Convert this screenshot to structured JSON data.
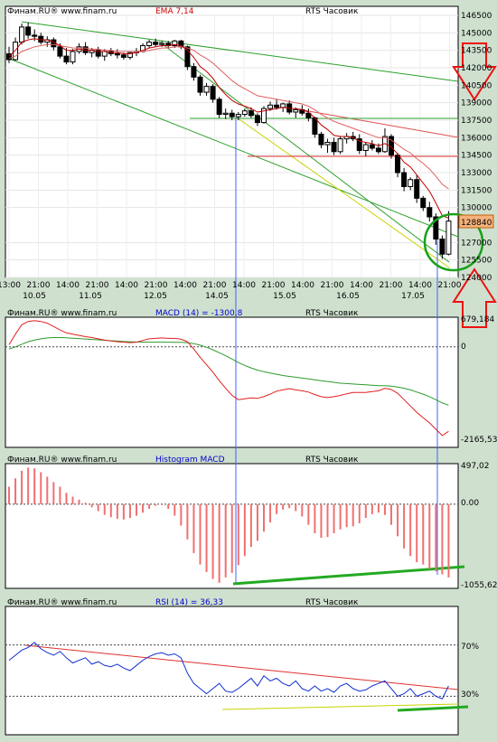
{
  "chart_data": [
    {
      "type": "candlestick",
      "header": {
        "source": "Финам.RU®  www.finam.ru",
        "indicator": "EMA 7,14",
        "instrument": "RTS Часовик"
      },
      "y_ticks": [
        "146500",
        "145000",
        "143500",
        "142000",
        "140500",
        "139000",
        "137500",
        "136000",
        "134500",
        "133000",
        "131500",
        "130000",
        "127000",
        "125500",
        "124000"
      ],
      "last_price_label": "128840",
      "ylim": [
        124000,
        146500
      ],
      "time_ticks": [
        "13:00",
        "21:00",
        "14:00",
        "21:00",
        "14:00",
        "21:00",
        "14:00",
        "21:00",
        "14:00",
        "21:00",
        "14:00",
        "21:00",
        "14:00",
        "21:00",
        "14:00",
        "21:00"
      ],
      "date_ticks": [
        "10.05",
        "11.05",
        "12.05",
        "14.05",
        "15.05",
        "16.05",
        "17.05"
      ],
      "candles": [
        [
          143200,
          143800,
          142400,
          142700
        ],
        [
          142700,
          144600,
          142600,
          144200
        ],
        [
          144200,
          145800,
          144000,
          145500
        ],
        [
          145500,
          145900,
          144500,
          144800
        ],
        [
          144800,
          145300,
          144300,
          144700
        ],
        [
          144700,
          145000,
          144000,
          144200
        ],
        [
          144200,
          144700,
          143800,
          144400
        ],
        [
          144400,
          144600,
          143500,
          143800
        ],
        [
          143800,
          144100,
          142800,
          143000
        ],
        [
          143000,
          143700,
          142300,
          142500
        ],
        [
          142500,
          143600,
          142300,
          143400
        ],
        [
          143400,
          144100,
          143200,
          143800
        ],
        [
          143800,
          144200,
          143100,
          143300
        ],
        [
          143300,
          143700,
          142900,
          143500
        ],
        [
          143500,
          143800,
          142800,
          143000
        ],
        [
          143000,
          143600,
          142600,
          143400
        ],
        [
          143400,
          143700,
          143000,
          143200
        ],
        [
          143200,
          143600,
          142800,
          143100
        ],
        [
          143100,
          143300,
          142700,
          142900
        ],
        [
          142900,
          143400,
          142700,
          143300
        ],
        [
          143300,
          143700,
          143000,
          143400
        ],
        [
          143400,
          144100,
          143300,
          143900
        ],
        [
          143900,
          144400,
          143700,
          144200
        ],
        [
          144200,
          144500,
          143800,
          144000
        ],
        [
          144000,
          144300,
          143800,
          144100
        ],
        [
          144100,
          144300,
          143700,
          143900
        ],
        [
          143900,
          144400,
          143700,
          144300
        ],
        [
          144300,
          144400,
          143600,
          143800
        ],
        [
          143800,
          143900,
          141800,
          142100
        ],
        [
          142100,
          142400,
          140900,
          141200
        ],
        [
          141200,
          141400,
          139600,
          139900
        ],
        [
          139900,
          140700,
          139600,
          140400
        ],
        [
          140400,
          140600,
          139000,
          139300
        ],
        [
          139300,
          139500,
          137700,
          138000
        ],
        [
          138000,
          138500,
          137600,
          138100
        ],
        [
          138100,
          138400,
          137500,
          137800
        ],
        [
          137800,
          138200,
          137500,
          138000
        ],
        [
          138000,
          138500,
          137800,
          138300
        ],
        [
          138300,
          138600,
          137700,
          137900
        ],
        [
          137900,
          138100,
          137000,
          137300
        ],
        [
          137300,
          138700,
          137200,
          138500
        ],
        [
          138500,
          139100,
          138300,
          138800
        ],
        [
          138800,
          139300,
          138400,
          138600
        ],
        [
          138600,
          139000,
          138200,
          138900
        ],
        [
          138900,
          139200,
          138000,
          138200
        ],
        [
          138200,
          138600,
          137700,
          138400
        ],
        [
          138400,
          138800,
          137900,
          138100
        ],
        [
          138100,
          138500,
          137400,
          137700
        ],
        [
          137700,
          137800,
          136000,
          136300
        ],
        [
          136300,
          136500,
          135100,
          135400
        ],
        [
          135400,
          135900,
          134700,
          135600
        ],
        [
          135600,
          136000,
          134500,
          134800
        ],
        [
          134800,
          136100,
          134600,
          135900
        ],
        [
          135900,
          136400,
          135500,
          136100
        ],
        [
          136100,
          136500,
          135700,
          135900
        ],
        [
          135900,
          136300,
          134600,
          134900
        ],
        [
          134900,
          135600,
          134400,
          135400
        ],
        [
          135400,
          135800,
          134900,
          135100
        ],
        [
          135100,
          135500,
          134600,
          134800
        ],
        [
          134800,
          136800,
          134700,
          136100
        ],
        [
          136100,
          136300,
          134200,
          134500
        ],
        [
          134500,
          134700,
          132600,
          133000
        ],
        [
          133000,
          133400,
          131400,
          131800
        ],
        [
          131800,
          132600,
          131500,
          132400
        ],
        [
          132400,
          132800,
          130400,
          130800
        ],
        [
          130800,
          131000,
          129700,
          130000
        ],
        [
          130000,
          130500,
          128800,
          129200
        ],
        [
          129200,
          129500,
          126800,
          127300
        ],
        [
          127300,
          127600,
          125600,
          126000
        ],
        [
          126000,
          129700,
          125900,
          128840
        ]
      ],
      "ema_fast": [
        143000,
        143500,
        144200,
        144400,
        144500,
        144400,
        144400,
        144200,
        143900,
        143500,
        143500,
        143600,
        143500,
        143500,
        143400,
        143400,
        143300,
        143300,
        143200,
        143200,
        143300,
        143500,
        143700,
        143800,
        143900,
        143900,
        144000,
        143900,
        143500,
        142900,
        142100,
        141700,
        141100,
        140300,
        139700,
        139200,
        138900,
        138700,
        138500,
        138200,
        138300,
        138400,
        138500,
        138600,
        138500,
        138500,
        138400,
        138200,
        137700,
        137100,
        136700,
        136200,
        136100,
        136100,
        136000,
        135700,
        135600,
        135500,
        135300,
        135500,
        135200,
        134600,
        133900,
        133500,
        132800,
        132100,
        131400,
        130400,
        129300,
        129100
      ],
      "ema_slow": [
        142800,
        143000,
        143400,
        143600,
        143800,
        143900,
        144000,
        144000,
        143900,
        143800,
        143700,
        143700,
        143700,
        143600,
        143600,
        143500,
        143500,
        143400,
        143400,
        143400,
        143400,
        143400,
        143500,
        143600,
        143700,
        143700,
        143800,
        143800,
        143700,
        143500,
        143100,
        142800,
        142400,
        141900,
        141400,
        140900,
        140500,
        140200,
        139900,
        139600,
        139500,
        139400,
        139300,
        139200,
        139100,
        139000,
        138900,
        138700,
        138400,
        138000,
        137700,
        137400,
        137200,
        137000,
        136800,
        136600,
        136400,
        136200,
        136000,
        136000,
        135800,
        135400,
        135000,
        134700,
        134200,
        133800,
        133300,
        132700,
        132000,
        131600
      ],
      "macd_header": {
        "source": "Финам.RU®  www.finam.ru",
        "indicator": "MACD (14) = -1300,8",
        "instrument": "RTS Часовик"
      },
      "macd_ticks": [
        "679,184",
        "0",
        "-2165,532"
      ],
      "macd_ylim": [
        -2165.532,
        679.184
      ],
      "macd_line": [
        50,
        300,
        520,
        600,
        620,
        600,
        560,
        480,
        400,
        330,
        300,
        270,
        240,
        220,
        190,
        160,
        140,
        120,
        110,
        100,
        110,
        150,
        190,
        200,
        210,
        200,
        200,
        180,
        120,
        -50,
        -250,
        -420,
        -600,
        -800,
        -980,
        -1150,
        -1250,
        -1230,
        -1210,
        -1220,
        -1180,
        -1120,
        -1050,
        -1020,
        -990,
        -1020,
        -1040,
        -1070,
        -1130,
        -1180,
        -1200,
        -1180,
        -1150,
        -1110,
        -1080,
        -1080,
        -1080,
        -1060,
        -1040,
        -980,
        -1010,
        -1100,
        -1250,
        -1400,
        -1550,
        -1680,
        -1800,
        -1950,
        -2100,
        -2000
      ],
      "macd_signal": [
        -50,
        0,
        60,
        120,
        160,
        190,
        210,
        220,
        220,
        215,
        205,
        195,
        185,
        175,
        165,
        155,
        145,
        135,
        125,
        120,
        115,
        112,
        110,
        110,
        110,
        110,
        108,
        105,
        95,
        75,
        40,
        -10,
        -70,
        -140,
        -210,
        -290,
        -370,
        -440,
        -500,
        -550,
        -590,
        -620,
        -650,
        -680,
        -700,
        -720,
        -740,
        -760,
        -780,
        -800,
        -820,
        -840,
        -860,
        -870,
        -880,
        -890,
        -900,
        -910,
        -920,
        -920,
        -930,
        -950,
        -980,
        -1020,
        -1070,
        -1120,
        -1180,
        -1250,
        -1330,
        -1380
      ],
      "hist_header": {
        "source": "Финам.RU®  www.finam.ru",
        "indicator": "Histogram MACD",
        "instrument": "RTS Часовик"
      },
      "hist_ticks": [
        "497,02",
        "0.00",
        "-1055,62"
      ],
      "hist_ylim": [
        -1055.62,
        497.02
      ],
      "histogram": [
        230,
        340,
        440,
        480,
        470,
        420,
        360,
        290,
        230,
        150,
        100,
        60,
        20,
        -40,
        -90,
        -140,
        -170,
        -190,
        -200,
        -180,
        -150,
        -110,
        -60,
        -20,
        -10,
        -60,
        -150,
        -280,
        -460,
        -640,
        -790,
        -890,
        -980,
        -1030,
        -960,
        -900,
        -800,
        -680,
        -560,
        -480,
        -360,
        -240,
        -130,
        -70,
        -50,
        -90,
        -160,
        -270,
        -380,
        -440,
        -430,
        -380,
        -330,
        -300,
        -290,
        -250,
        -180,
        -130,
        -110,
        -140,
        -270,
        -420,
        -580,
        -680,
        -760,
        -790,
        -850,
        -880,
        -920,
        -960
      ],
      "rsi_header": {
        "source": "Финам.RU®  www.finam.ru",
        "indicator": "RSI (14) = 36,33",
        "instrument": "RTS Часовик"
      },
      "rsi_ticks": [
        "70%",
        "30%"
      ],
      "rsi_ylim": [
        0,
        100
      ],
      "rsi": [
        58,
        62,
        66,
        68,
        72,
        67,
        64,
        62,
        65,
        60,
        56,
        58,
        60,
        55,
        57,
        54,
        53,
        55,
        52,
        50,
        54,
        58,
        61,
        63,
        64,
        62,
        63,
        60,
        48,
        40,
        36,
        32,
        36,
        40,
        34,
        33,
        36,
        40,
        44,
        38,
        46,
        42,
        44,
        40,
        38,
        42,
        36,
        34,
        38,
        34,
        36,
        33,
        38,
        40,
        36,
        34,
        35,
        38,
        40,
        42,
        36,
        30,
        32,
        36,
        30,
        32,
        34,
        30,
        28,
        38
      ]
    }
  ]
}
